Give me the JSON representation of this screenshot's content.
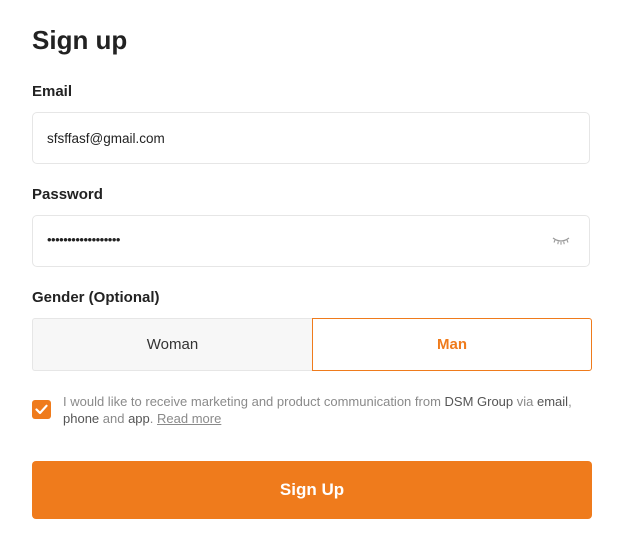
{
  "page": {
    "title": "Sign up"
  },
  "email": {
    "label": "Email",
    "value": "sfsffasf@gmail.com"
  },
  "password": {
    "label": "Password",
    "masked_value": "••••••••••••••••••",
    "toggle_icon": "eye-closed-icon"
  },
  "gender": {
    "label": "Gender (Optional)",
    "options": [
      "Woman",
      "Man"
    ],
    "selected": "Man"
  },
  "consent": {
    "checked": true,
    "text_part1": "I would like to receive marketing and product communication from ",
    "company": "DSM Group",
    "text_part2": " via ",
    "channel_email": "email",
    "text_part3": ", ",
    "channel_phone": "phone",
    "text_part4": " and ",
    "channel_app": "app",
    "text_part5": ". ",
    "read_more": "Read more"
  },
  "submit": {
    "label": "Sign Up"
  },
  "colors": {
    "accent": "#ef7b1c",
    "text": "#222222",
    "muted": "#8a8a8a",
    "border": "#e6e6e6",
    "unselected_bg": "#f7f7f7"
  }
}
